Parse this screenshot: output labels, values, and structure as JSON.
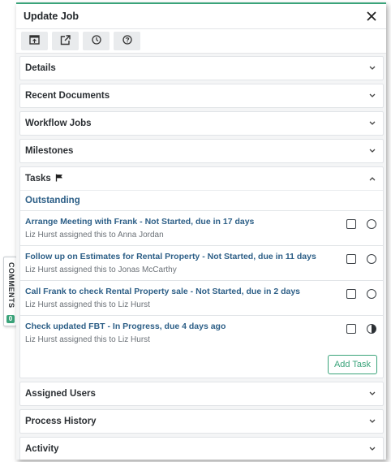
{
  "header": {
    "title": "Update Job",
    "close_icon": "close-icon"
  },
  "toolbar": {
    "buttons": [
      {
        "name": "open-window-icon"
      },
      {
        "name": "external-link-icon"
      },
      {
        "name": "clock-icon"
      },
      {
        "name": "help-icon"
      }
    ]
  },
  "sections": {
    "details": "Details",
    "recent_documents": "Recent Documents",
    "workflow_jobs": "Workflow Jobs",
    "milestones": "Milestones",
    "tasks": "Tasks",
    "assigned_users": "Assigned Users",
    "process_history": "Process History",
    "activity": "Activity"
  },
  "tasks": {
    "group_label": "Outstanding",
    "items": [
      {
        "title": "Arrange Meeting with Frank - Not Started, due in 17 days",
        "assignment": "Liz Hurst assigned this to Anna Jordan",
        "status": "not-started"
      },
      {
        "title": "Follow up on Estimates for Rental Property - Not Started, due in 11 days",
        "assignment": "Liz Hurst assigned this to Jonas McCarthy",
        "status": "not-started"
      },
      {
        "title": "Call Frank to check Rental Property sale - Not Started, due in 2 days",
        "assignment": "Liz Hurst assigned this to Liz Hurst",
        "status": "not-started"
      },
      {
        "title": "Check updated FBT - In Progress, due 4 days ago",
        "assignment": "Liz Hurst assigned this to Liz Hurst",
        "status": "in-progress"
      }
    ],
    "add_label": "Add Task"
  },
  "comments": {
    "label": "COMMENTS",
    "count": "0"
  },
  "colors": {
    "accent": "#3aa37a",
    "link": "#2d5f87",
    "panel_bg": "#f4f5f6"
  }
}
